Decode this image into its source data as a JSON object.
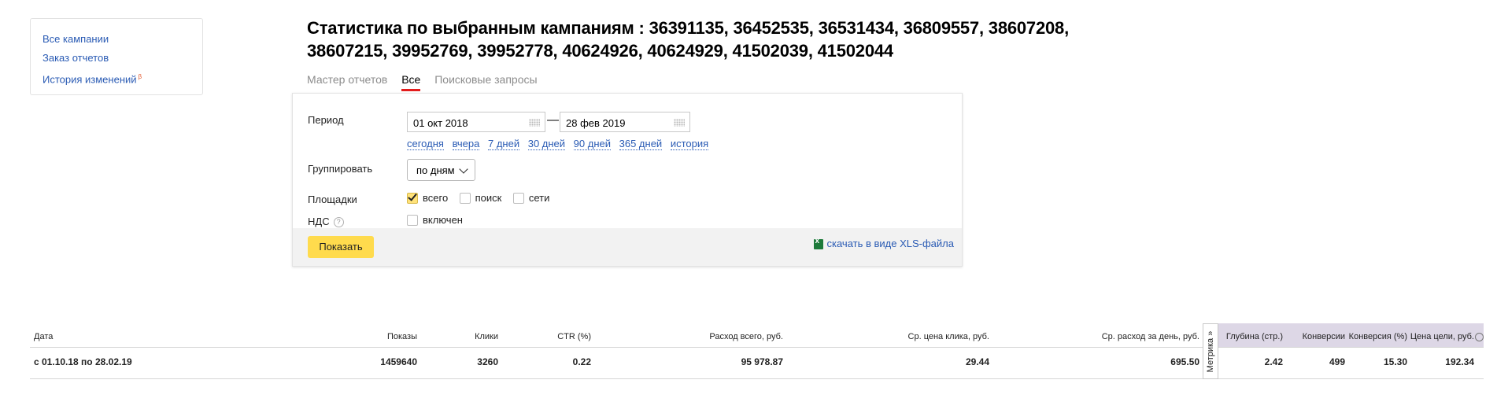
{
  "sidebar": {
    "items": [
      {
        "label": "Все кампании"
      },
      {
        "label": "Заказ отчетов"
      },
      {
        "label": "История изменений",
        "badge": "β"
      }
    ]
  },
  "title": "Статистика по выбранным кампаниям : 36391135, 36452535, 36531434, 36809557, 38607208, 38607215, 39952769, 39952778, 40624926, 40624929, 41502039, 41502044",
  "tabs": [
    {
      "label": "Мастер отчетов",
      "active": false
    },
    {
      "label": "Все",
      "active": true
    },
    {
      "label": "Поисковые запросы",
      "active": false
    }
  ],
  "form": {
    "period_label": "Период",
    "date_from": "01 окт 2018",
    "date_to": "28 фев 2019",
    "dash": "—",
    "quick_periods": [
      "сегодня",
      "вчера",
      "7 дней",
      "30 дней",
      "90 дней",
      "365 дней",
      "история"
    ],
    "group_label": "Группировать",
    "group_value": "по дням",
    "sites_label": "Площадки",
    "sites": [
      {
        "label": "всего",
        "checked": true
      },
      {
        "label": "поиск",
        "checked": false
      },
      {
        "label": "сети",
        "checked": false
      }
    ],
    "vat_label": "НДС",
    "vat_help": "?",
    "vat_option": "включен",
    "vat_checked": false,
    "show_button": "Показать",
    "xls_link": "скачать в виде XLS-файла"
  },
  "colors": {
    "link": "#2a5bb4",
    "active_tab_underline": "#e31c1c",
    "button": "#ffdb4d",
    "metrika_header": "#ddd7e6"
  },
  "table": {
    "headers": {
      "date": "Дата",
      "shows": "Показы",
      "clicks": "Клики",
      "ctr": "CTR (%)",
      "spend": "Расход всего, руб.",
      "avg_cpc": "Ср. цена клика, руб.",
      "avg_daily": "Ср. расход за день, руб.",
      "depth": "Глубина (стр.)",
      "conversions": "Конверсии",
      "conversion_rate": "Конверсия (%)",
      "goal_price": "Цена цели, руб."
    },
    "metrika_tab": "Метрика »",
    "row": {
      "date": "с 01.10.18 по 28.02.19",
      "shows": "1459640",
      "clicks": "3260",
      "ctr": "0.22",
      "spend": "95 978.87",
      "avg_cpc": "29.44",
      "avg_daily": "695.50",
      "depth": "2.42",
      "conversions": "499",
      "conversion_rate": "15.30",
      "goal_price": "192.34"
    }
  }
}
